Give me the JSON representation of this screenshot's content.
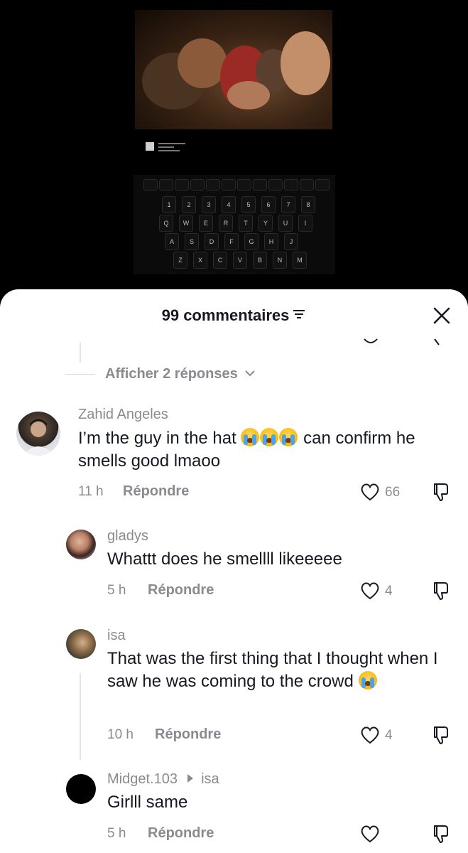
{
  "header": {
    "title": "99 commentaires"
  },
  "thread": {
    "view_replies_label": "Afficher 2 réponses"
  },
  "comments": [
    {
      "username": "Zahid Angeles",
      "text_before_emoji": "I’m the guy in the hat",
      "emoji": "😭😭😭",
      "text_after_emoji": "can confirm he smells good lmaoo",
      "time": "11 h",
      "reply_label": "Répondre",
      "likes": "66"
    },
    {
      "username": "gladys",
      "text": "Whattt does he smellll likeeeee",
      "time": "5 h",
      "reply_label": "Répondre",
      "likes": "4"
    },
    {
      "username": "isa",
      "text": "That was the first thing that I thought when I saw he was coming to the crowd",
      "emoji": "😭",
      "time": "10 h",
      "reply_label": "Répondre",
      "likes": "4"
    },
    {
      "username": "Midget.103",
      "reply_to": "isa",
      "text": "Girlll same",
      "time": "5 h",
      "reply_label": "Répondre",
      "likes": ""
    }
  ],
  "keyboard": {
    "row1": [
      "Q",
      "W",
      "E",
      "R",
      "T",
      "Y",
      "U",
      "I"
    ],
    "row2": [
      "A",
      "S",
      "D",
      "F",
      "G",
      "H",
      "J"
    ],
    "row3": [
      "Z",
      "X",
      "C",
      "V",
      "B",
      "N",
      "M"
    ],
    "numbers": [
      "1",
      "2",
      "3",
      "4",
      "5",
      "6",
      "7",
      "8"
    ]
  },
  "colors": {
    "text_primary": "#161823",
    "text_secondary": "#8a8b91",
    "sheet_bg": "#ffffff",
    "video_bg": "#000000"
  },
  "icons": {
    "filter": "filter-icon",
    "close": "close-icon",
    "like": "heart-outline-icon",
    "dislike": "thumbs-down-icon",
    "reply_arrow": "triangle-right-icon",
    "emoji": "loudly-crying-face-emoji"
  }
}
